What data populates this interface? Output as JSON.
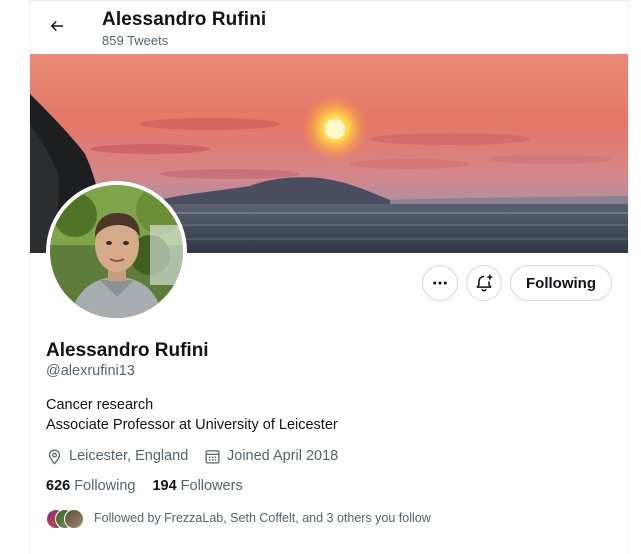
{
  "header": {
    "title": "Alessandro Rufini",
    "tweet_count": "859 Tweets"
  },
  "profile": {
    "name": "Alessandro Rufini",
    "handle": "@alexrufini13",
    "bio_lines": [
      "Cancer research",
      "Associate Professor at University of Leicester"
    ],
    "location": "Leicester, England",
    "joined": "Joined April 2018",
    "following_count": "626",
    "following_label": "Following",
    "followers_count": "194",
    "followers_label": "Followers",
    "followed_by": "Followed by FrezzaLab, Seth Coffelt, and 3 others you follow"
  },
  "actions": {
    "follow_button": "Following"
  },
  "icons": {
    "back": "arrow-left-icon",
    "more": "more-dots-icon",
    "notify": "bell-plus-icon",
    "location": "location-pin-icon",
    "calendar": "calendar-icon"
  },
  "colors": {
    "text_primary": "#0f1419",
    "text_secondary": "#536471",
    "border": "#cfd9de"
  }
}
